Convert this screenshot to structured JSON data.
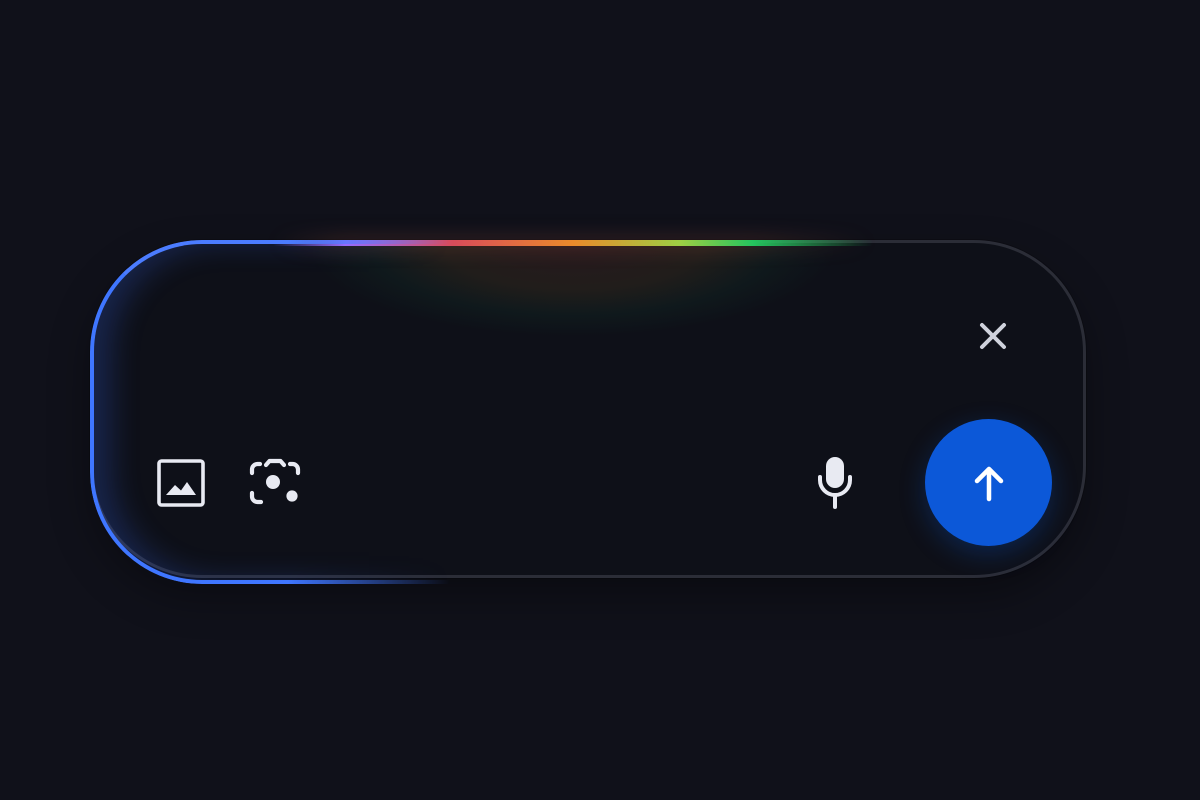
{
  "prompt": {
    "value": "",
    "placeholder": ""
  },
  "toolbar": {
    "clear_icon": "close-icon",
    "image_icon": "image-icon",
    "lens_icon": "camera-lens-icon",
    "mic_icon": "microphone-icon",
    "send_icon": "arrow-up-icon"
  },
  "colors": {
    "background": "#10111a",
    "surface": "#0e1018",
    "border": "#2b2d37",
    "icon": "#e8eaf2",
    "accent_blue": "#0c58d8",
    "edge_blue": "#3f76ff",
    "rainbow_purple": "#9c6cff",
    "rainbow_red": "#d84b5a",
    "rainbow_orange": "#ea8a2b",
    "rainbow_yellow_green": "#9dcf44",
    "rainbow_green": "#24c35e"
  }
}
